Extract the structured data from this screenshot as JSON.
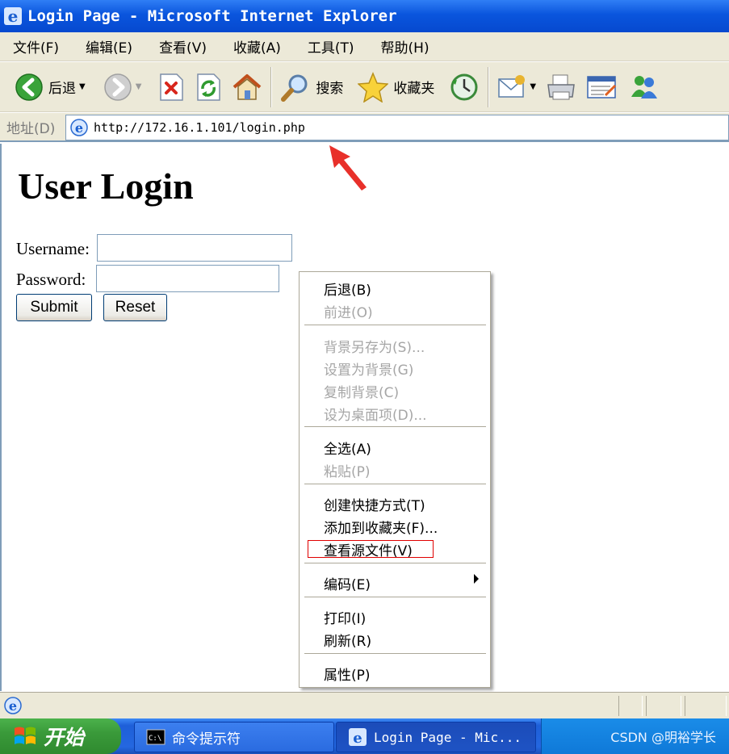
{
  "window": {
    "title": "Login Page - Microsoft Internet Explorer"
  },
  "menubar": {
    "items": [
      "文件(F)",
      "编辑(E)",
      "查看(V)",
      "收藏(A)",
      "工具(T)",
      "帮助(H)"
    ]
  },
  "toolbar": {
    "back_label": "后退",
    "search_label": "搜索",
    "favorites_label": "收藏夹",
    "icons": [
      "back-arrow-icon",
      "forward-arrow-icon",
      "stop-icon",
      "refresh-icon",
      "home-icon",
      "search-icon",
      "favorites-star-icon",
      "history-icon",
      "mail-icon",
      "print-icon",
      "edit-icon",
      "messenger-icon"
    ]
  },
  "addressbar": {
    "label": "地址(D)",
    "url": "http://172.16.1.101/login.php"
  },
  "page": {
    "heading": "User Login",
    "username_label": "Username:",
    "password_label": "Password:",
    "username_value": "",
    "password_value": "",
    "submit_label": "Submit",
    "reset_label": "Reset"
  },
  "context_menu": {
    "items": [
      {
        "label": "后退(B)",
        "enabled": true
      },
      {
        "label": "前进(O)",
        "enabled": false
      },
      {
        "label": "背景另存为(S)...",
        "enabled": false
      },
      {
        "label": "设置为背景(G)",
        "enabled": false
      },
      {
        "label": "复制背景(C)",
        "enabled": false
      },
      {
        "label": "设为桌面项(D)...",
        "enabled": false
      },
      {
        "label": "全选(A)",
        "enabled": true
      },
      {
        "label": "粘贴(P)",
        "enabled": false
      },
      {
        "label": "创建快捷方式(T)",
        "enabled": true
      },
      {
        "label": "添加到收藏夹(F)...",
        "enabled": true
      },
      {
        "label": "查看源文件(V)",
        "enabled": true,
        "highlighted": true
      },
      {
        "label": "编码(E)",
        "enabled": true,
        "submenu": true
      },
      {
        "label": "打印(I)",
        "enabled": true
      },
      {
        "label": "刷新(R)",
        "enabled": true
      },
      {
        "label": "属性(P)",
        "enabled": true
      }
    ]
  },
  "annotation": {
    "arrow_color": "#e8302a",
    "highlight_color": "#e00000"
  },
  "taskbar": {
    "start_label": "开始",
    "tasks": [
      {
        "label": "命令提示符",
        "icon": "cmd-icon"
      },
      {
        "label": "Login Page - Mic...",
        "icon": "ie-icon"
      }
    ],
    "tray_text": "CSDN @明裕学长"
  },
  "colors": {
    "titlebar": "#0a55dd",
    "chrome": "#ece9d8",
    "start_button": "#3a9a3a",
    "taskbar": "#2467e0"
  }
}
